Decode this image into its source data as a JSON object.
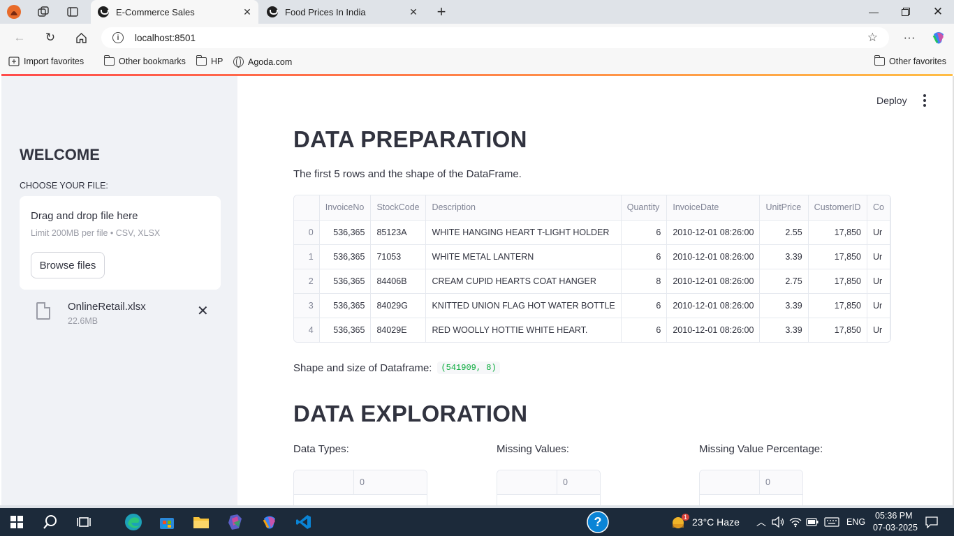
{
  "browser": {
    "tabs": [
      {
        "title": "E-Commerce Sales",
        "active": true
      },
      {
        "title": "Food Prices In India",
        "active": false
      }
    ],
    "url": "localhost:8501",
    "bookmarks": [
      "Import favorites",
      "Other bookmarks",
      "HP",
      "Agoda.com"
    ],
    "other_favorites": "Other favorites"
  },
  "sidebar": {
    "title": "WELCOME",
    "choose_label": "CHOOSE YOUR FILE:",
    "dropzone_title": "Drag and drop file here",
    "dropzone_limit": "Limit 200MB per file • CSV, XLSX",
    "browse_label": "Browse files",
    "file_name": "OnlineRetail.xlsx",
    "file_size": "22.6MB"
  },
  "header": {
    "deploy": "Deploy"
  },
  "main": {
    "heading1": "DATA PREPARATION",
    "intro": "The first 5 rows and the shape of the DataFrame.",
    "table": {
      "columns": [
        "",
        "InvoiceNo",
        "StockCode",
        "Description",
        "Quantity",
        "InvoiceDate",
        "UnitPrice",
        "CustomerID",
        "Co"
      ],
      "rows": [
        [
          "0",
          "536,365",
          "85123A",
          "WHITE HANGING HEART T-LIGHT HOLDER",
          "6",
          "2010-12-01 08:26:00",
          "2.55",
          "17,850",
          "Ur"
        ],
        [
          "1",
          "536,365",
          "71053",
          "WHITE METAL LANTERN",
          "6",
          "2010-12-01 08:26:00",
          "3.39",
          "17,850",
          "Ur"
        ],
        [
          "2",
          "536,365",
          "84406B",
          "CREAM CUPID HEARTS COAT HANGER",
          "8",
          "2010-12-01 08:26:00",
          "2.75",
          "17,850",
          "Ur"
        ],
        [
          "3",
          "536,365",
          "84029G",
          "KNITTED UNION FLAG HOT WATER BOTTLE",
          "6",
          "2010-12-01 08:26:00",
          "3.39",
          "17,850",
          "Ur"
        ],
        [
          "4",
          "536,365",
          "84029E",
          "RED WOOLLY HOTTIE WHITE HEART.",
          "6",
          "2010-12-01 08:26:00",
          "3.39",
          "17,850",
          "Ur"
        ]
      ]
    },
    "shape_label": "Shape and size of Dataframe:",
    "shape_value": "(541909, 8)",
    "heading2": "DATA EXPLORATION",
    "sub1": "Data Types:",
    "sub2": "Missing Values:",
    "sub3": "Missing Value Percentage:",
    "mini_col": "0"
  },
  "taskbar": {
    "weather": "23°C  Haze",
    "badge": "1",
    "lang": "ENG",
    "time": "05:36 PM",
    "date": "07-03-2025"
  },
  "colors": {
    "accent_start": "#ff4b4b",
    "accent_end": "#ffbd45",
    "code_green": "#09ab3b"
  }
}
